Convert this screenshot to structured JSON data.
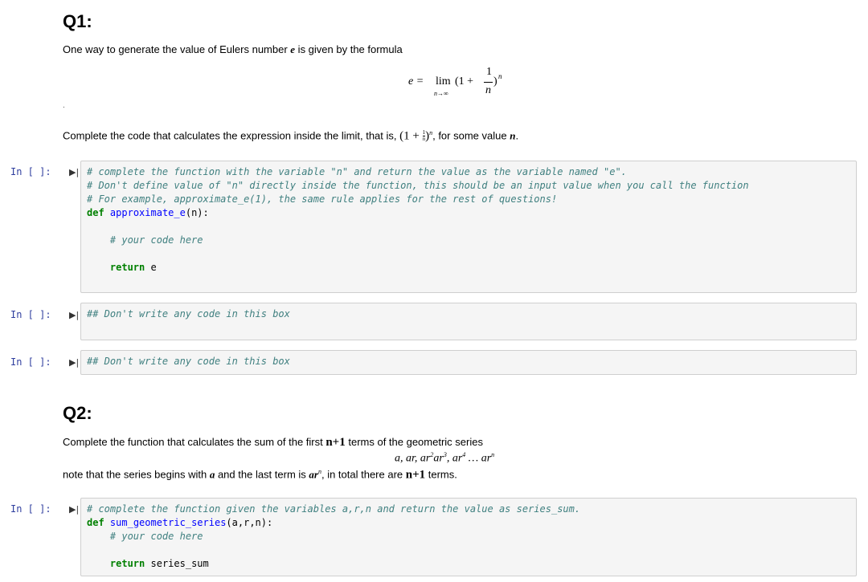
{
  "q1": {
    "heading": "Q1:",
    "intro_pre": "One way to generate the value of Eulers number ",
    "intro_var": "e",
    "intro_post": " is given by the formula",
    "formula": {
      "lhs": "e =",
      "lim": "lim",
      "lim_sub": "n→∞",
      "open": "(1 +",
      "num": "1",
      "den": "n",
      "close": ")",
      "exp": "n"
    },
    "dot": ".",
    "instruction_pre": "Complete the code that calculates the expression inside the limit, that is, ",
    "instruction_expr_open": "(1 + ",
    "instruction_expr_num": "1",
    "instruction_expr_den": "n",
    "instruction_expr_close": ")",
    "instruction_expr_exp": "n",
    "instruction_mid": ", for some value ",
    "instruction_var": "n",
    "instruction_end": "."
  },
  "cells": [
    {
      "prompt": "In [ ]:",
      "lines": [
        "# complete the function with the variable \"n\" and return the value as the variable named \"e\".",
        "# Don't define value of \"n\" directly inside the function, this should be an input value when you call the function",
        "# For example, approximate_e(1), the same rule applies for the rest of questions!"
      ],
      "def_kw": "def",
      "def_name": "approximate_e",
      "def_args": "(n):",
      "comment": "# your code here",
      "return_kw": "return",
      "return_val": " e"
    },
    {
      "prompt": "In [ ]:",
      "comment": "## Don't write any code in this box"
    },
    {
      "prompt": "In [ ]:",
      "comment": "## Don't write any code in this box"
    },
    {
      "prompt": "In [ ]:",
      "line1": "# complete the function given the variables a,r,n and return the value as series_sum.",
      "def_kw": "def",
      "def_name": "sum_geometric_series",
      "def_args": "(a,r,n):",
      "comment": "# your code here",
      "return_kw": "return",
      "return_val": " series_sum"
    }
  ],
  "q2": {
    "heading": "Q2:",
    "intro_pre": "Complete the function that calculates the sum of the first ",
    "intro_bold": "n+1",
    "intro_post": " terms of the geometric series",
    "series": {
      "t1": "a, ar, ar",
      "e2": "2",
      "t2": "ar",
      "e3": "3",
      "t3": ", ar",
      "e4": "4",
      "t4": " … ar",
      "en": "n"
    },
    "note_pre": "note that the series begins with ",
    "note_a": "a",
    "note_mid": " and the last term is ",
    "note_ar": "ar",
    "note_exp": "n",
    "note_mid2": ", in total there are ",
    "note_bold": "n+1",
    "note_end": " terms."
  },
  "run_icon": "▶|"
}
